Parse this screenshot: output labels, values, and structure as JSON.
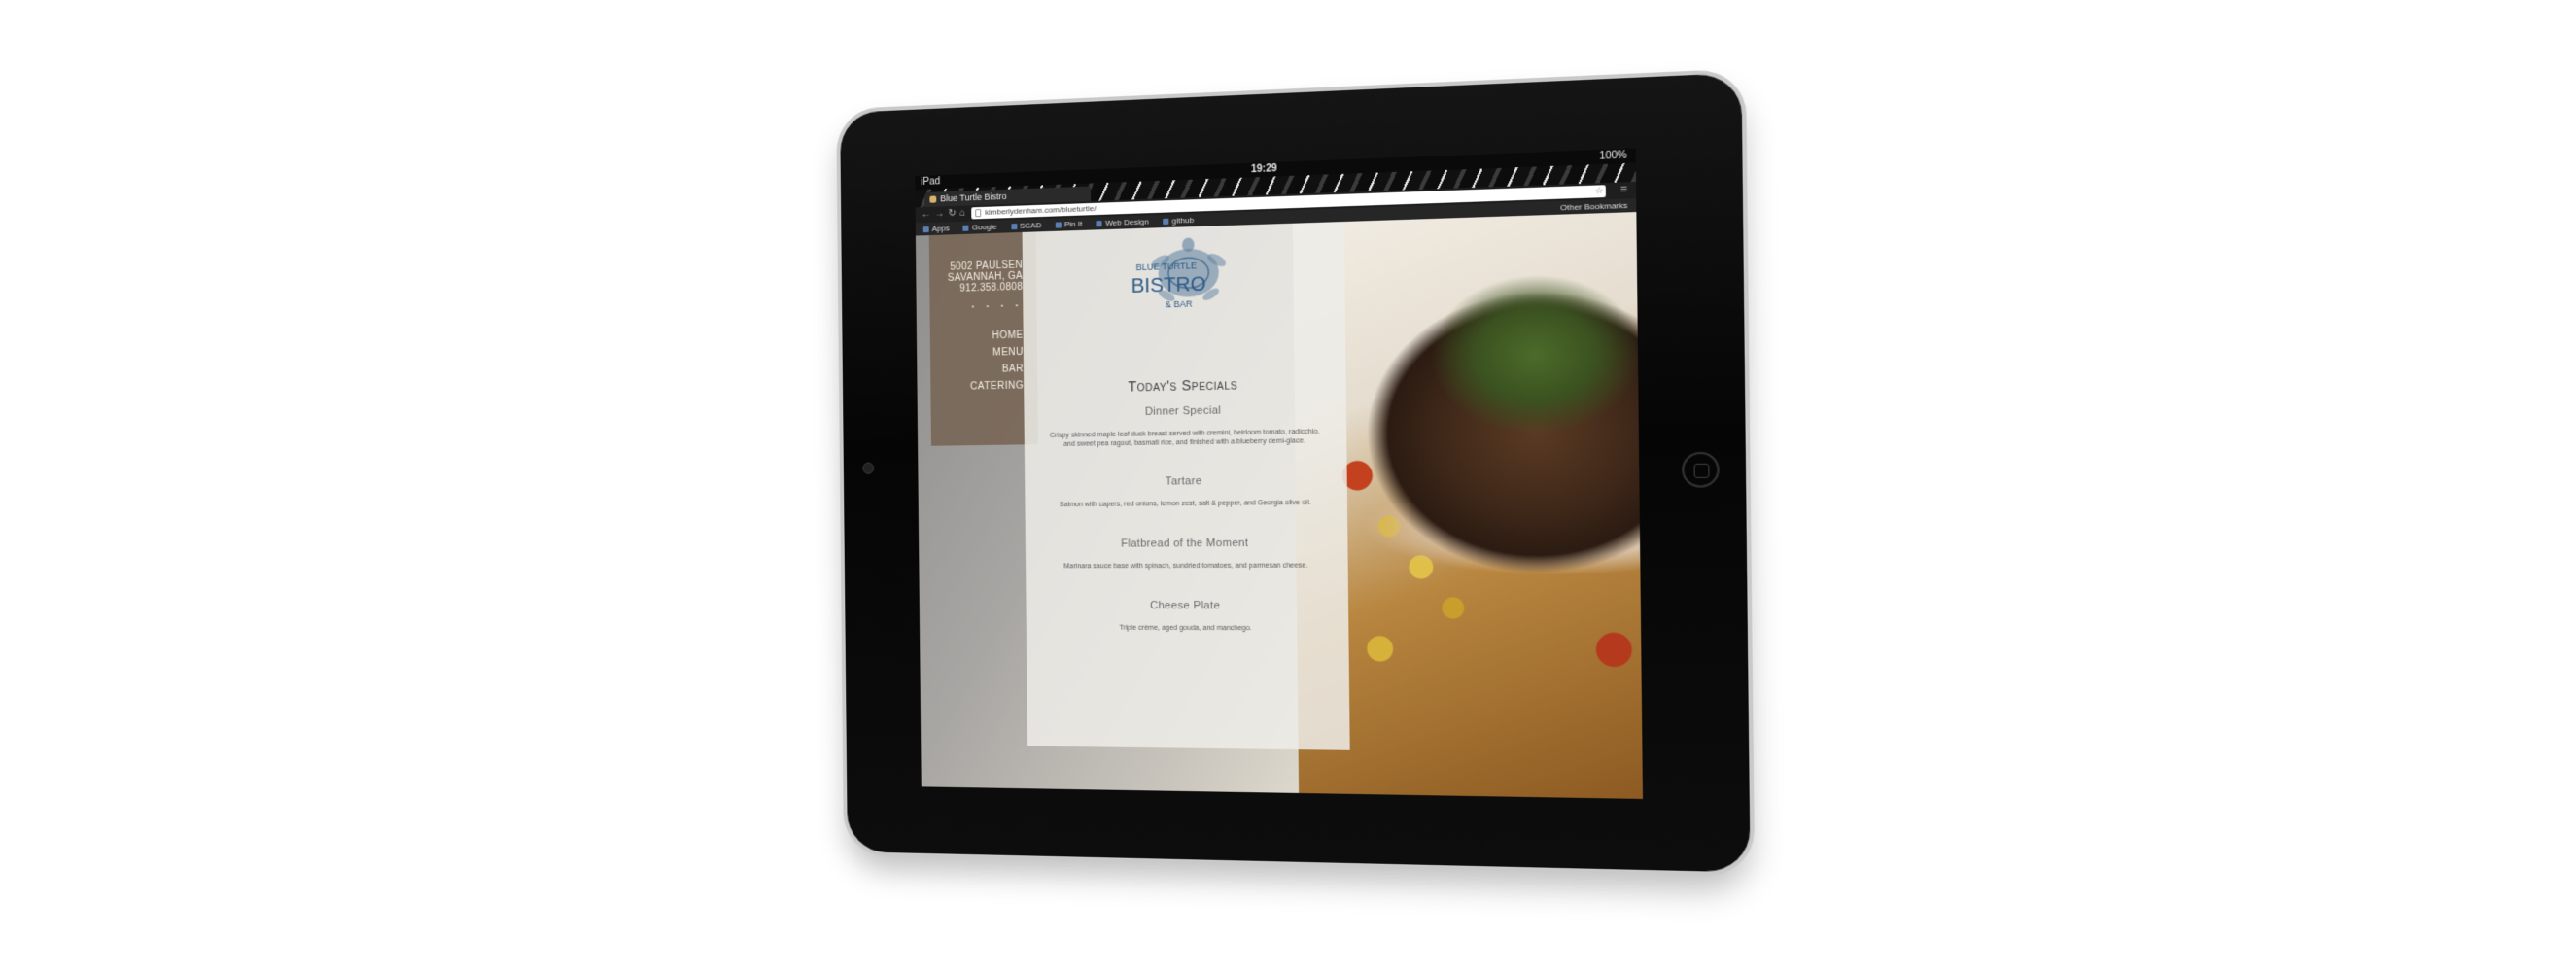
{
  "device": {
    "stand_color": "#f07b30",
    "bezel_color": "#0b0b0b"
  },
  "status_bar": {
    "carrier": "iPad",
    "time": "19:29",
    "battery": "100%"
  },
  "browser": {
    "tab_title": "Blue Turtle Bistro",
    "url": "kimberlydenham.com/blueturtle/",
    "bookmarks": [
      "Apps",
      "Google",
      "SCAD",
      "Pin It",
      "Web Design",
      "github"
    ],
    "other_bookmarks": "Other Bookmarks"
  },
  "site": {
    "address": [
      "5002 PAULSEN",
      "SAVANNAH, GA",
      "912.358.0808"
    ],
    "dots": "• • • •",
    "nav": [
      "HOME",
      "MENU",
      "BAR",
      "CATERING"
    ],
    "logo": {
      "line1": "BLUE TURTLE",
      "line2": "BISTRO",
      "line3": "& BAR",
      "color": "#2f5b86"
    },
    "specials_title": "Today's Specials",
    "dishes": [
      {
        "name": "Dinner Special",
        "desc": "Crispy skinned maple leaf duck breast served with cremini, heirloom tomato, radicchio, and sweet pea ragout, basmati rice, and finished with a blueberry demi-glace."
      },
      {
        "name": "Tartare",
        "desc": "Salmon with capers, red onions, lemon zest, salt & pepper, and Georgia olive oil."
      },
      {
        "name": "Flatbread of the Moment",
        "desc": "Marinara sauce base with spinach, sundried tomatoes, and parmesan cheese."
      },
      {
        "name": "Cheese Plate",
        "desc": "Triple crème, aged gouda, and manchego."
      }
    ]
  }
}
